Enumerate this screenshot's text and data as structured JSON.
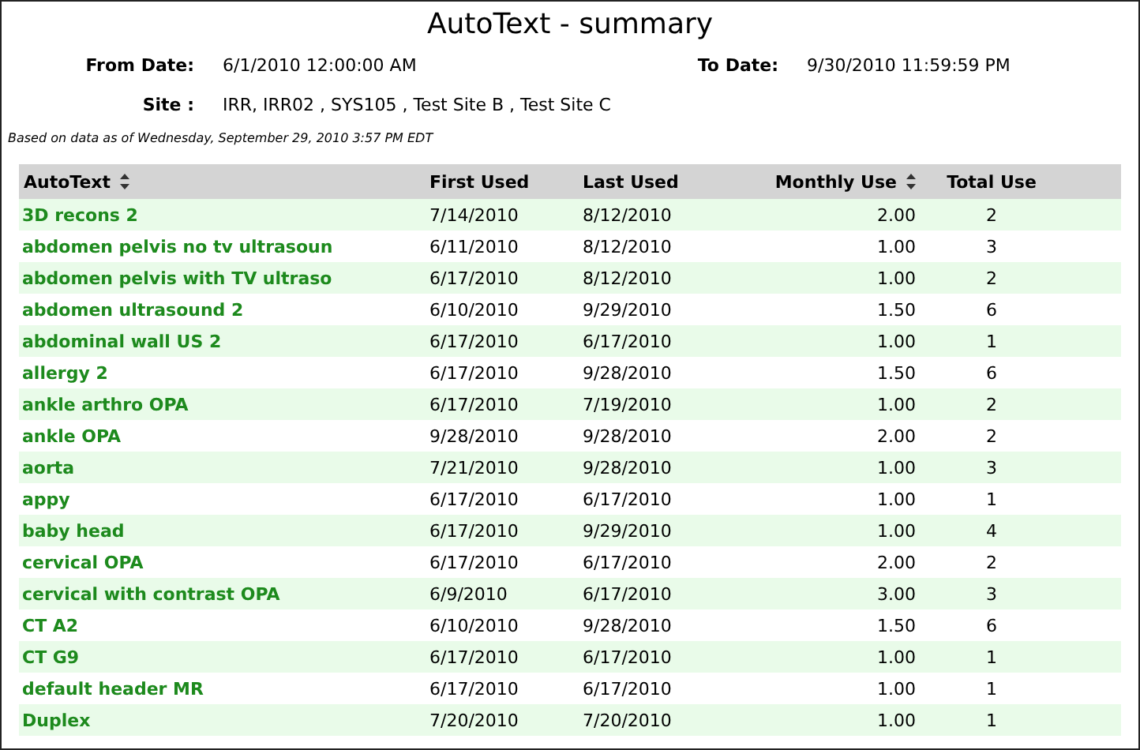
{
  "title": "AutoText - summary",
  "from_date": {
    "label": "From Date:",
    "value": "6/1/2010 12:00:00 AM"
  },
  "to_date": {
    "label": "To Date:",
    "value": "9/30/2010 11:59:59 PM"
  },
  "site": {
    "label": "Site :",
    "value": "IRR, IRR02 , SYS105 , Test Site B , Test Site C"
  },
  "note": "Based on data as of Wednesday, September 29, 2010 3:57 PM EDT",
  "table": {
    "columns": [
      {
        "label": "AutoText",
        "sortable": true
      },
      {
        "label": "First Used",
        "sortable": false
      },
      {
        "label": "Last Used",
        "sortable": false
      },
      {
        "label": "Monthly Use",
        "sortable": true
      },
      {
        "label": "Total Use",
        "sortable": false
      }
    ],
    "rows": [
      [
        "3D recons 2",
        "7/14/2010",
        "8/12/2010",
        "2.00",
        "2"
      ],
      [
        "abdomen pelvis no tv ultrasoun",
        "6/11/2010",
        "8/12/2010",
        "1.00",
        "3"
      ],
      [
        "abdomen pelvis with TV ultraso",
        "6/17/2010",
        "8/12/2010",
        "1.00",
        "2"
      ],
      [
        "abdomen ultrasound 2",
        "6/10/2010",
        "9/29/2010",
        "1.50",
        "6"
      ],
      [
        "abdominal wall US 2",
        "6/17/2010",
        "6/17/2010",
        "1.00",
        "1"
      ],
      [
        "allergy 2",
        "6/17/2010",
        "9/28/2010",
        "1.50",
        "6"
      ],
      [
        "ankle arthro OPA",
        "6/17/2010",
        "7/19/2010",
        "1.00",
        "2"
      ],
      [
        "ankle OPA",
        "9/28/2010",
        "9/28/2010",
        "2.00",
        "2"
      ],
      [
        "aorta",
        "7/21/2010",
        "9/28/2010",
        "1.00",
        "3"
      ],
      [
        "appy",
        "6/17/2010",
        "6/17/2010",
        "1.00",
        "1"
      ],
      [
        "baby head",
        "6/17/2010",
        "9/29/2010",
        "1.00",
        "4"
      ],
      [
        "cervical OPA",
        "6/17/2010",
        "6/17/2010",
        "2.00",
        "2"
      ],
      [
        "cervical with contrast OPA",
        "6/9/2010",
        "6/17/2010",
        "3.00",
        "3"
      ],
      [
        "CT A2",
        "6/10/2010",
        "9/28/2010",
        "1.50",
        "6"
      ],
      [
        "CT G9",
        "6/17/2010",
        "6/17/2010",
        "1.00",
        "1"
      ],
      [
        "default header MR",
        "6/17/2010",
        "6/17/2010",
        "1.00",
        "1"
      ],
      [
        "Duplex",
        "7/20/2010",
        "7/20/2010",
        "1.00",
        "1"
      ]
    ]
  }
}
